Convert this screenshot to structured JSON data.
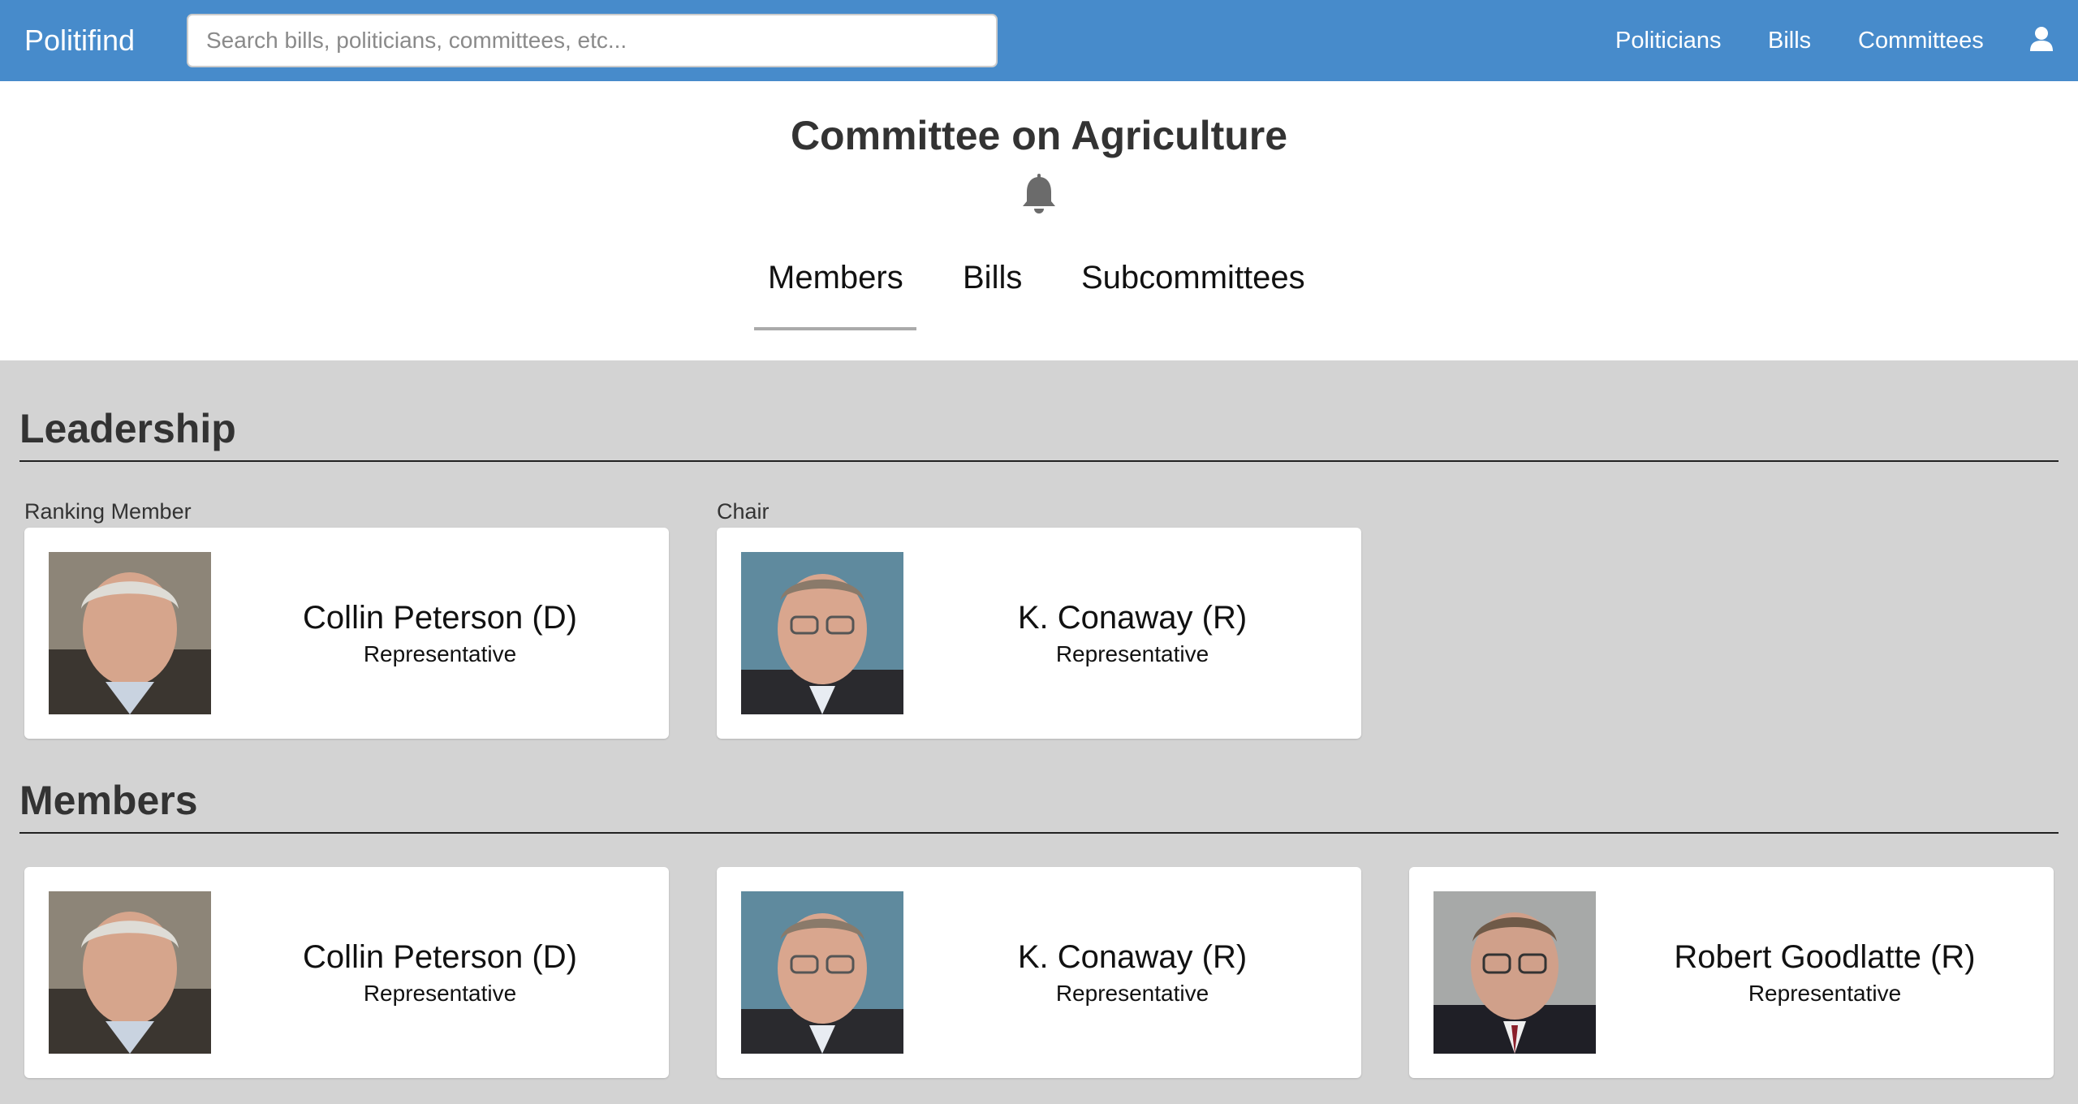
{
  "navbar": {
    "brand": "Politifind",
    "search_placeholder": "Search bills, politicians, committees, etc...",
    "links": [
      "Politicians",
      "Bills",
      "Committees"
    ],
    "user_icon": "user-icon"
  },
  "header": {
    "title": "Committee on Agriculture",
    "bell_icon": "bell-icon",
    "tabs": [
      "Members",
      "Bills",
      "Subcommittees"
    ],
    "active_tab": "Members"
  },
  "leadership": {
    "title": "Leadership",
    "cards": [
      {
        "role_label": "Ranking Member",
        "name": "Collin Peterson (D)",
        "position": "Representative"
      },
      {
        "role_label": "Chair",
        "name": "K. Conaway (R)",
        "position": "Representative"
      }
    ]
  },
  "members": {
    "title": "Members",
    "cards": [
      {
        "name": "Collin Peterson (D)",
        "position": "Representative"
      },
      {
        "name": "K. Conaway (R)",
        "position": "Representative"
      },
      {
        "name": "Robert Goodlatte (R)",
        "position": "Representative"
      }
    ]
  },
  "colors": {
    "navbar": "#478bcb",
    "content_bg": "#d3d3d3",
    "header_bg": "#ffffff"
  }
}
